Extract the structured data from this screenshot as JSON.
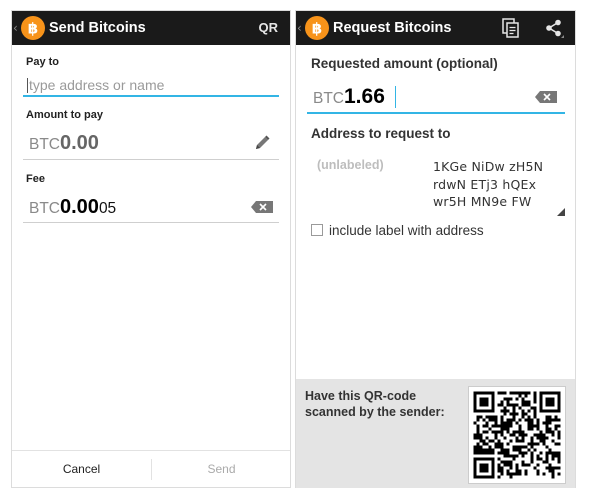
{
  "send_screen": {
    "title": "Send Bitcoins",
    "qr_action": "QR",
    "pay_to_label": "Pay to",
    "pay_to_placeholder": "type address or name",
    "amount_label": "Amount to pay",
    "amount_currency": "BTC",
    "amount_value": "0.00",
    "fee_label": "Fee",
    "fee_currency": "BTC",
    "fee_value_main": "0.00",
    "fee_value_small": "05",
    "cancel_button": "Cancel",
    "send_button": "Send"
  },
  "request_screen": {
    "title": "Request Bitcoins",
    "amount_label": "Requested amount (optional)",
    "amount_currency": "BTC",
    "amount_value": "1.66",
    "address_label": "Address to request to",
    "address_tag": "(unlabeled)",
    "address_line_1": "1KGe NiDw zH5N",
    "address_line_2": "rdwN ETj3 hQEx",
    "address_line_3": "wr5H MN9e FW",
    "include_label_text": "include label with address",
    "include_label_checked": false,
    "qr_instruction": "Have this QR-code scanned by the sender:"
  },
  "colors": {
    "actionbar": "#1a1a1a",
    "bitcoin_orange": "#f7931a",
    "focus_blue": "#33b5e5",
    "qr_panel": "#e4e4e4"
  },
  "icons": {
    "app": "bitcoin-logo-icon",
    "edit": "pencil-icon",
    "clear": "backspace-icon",
    "copy": "copy-document-icon",
    "share": "share-icon"
  }
}
